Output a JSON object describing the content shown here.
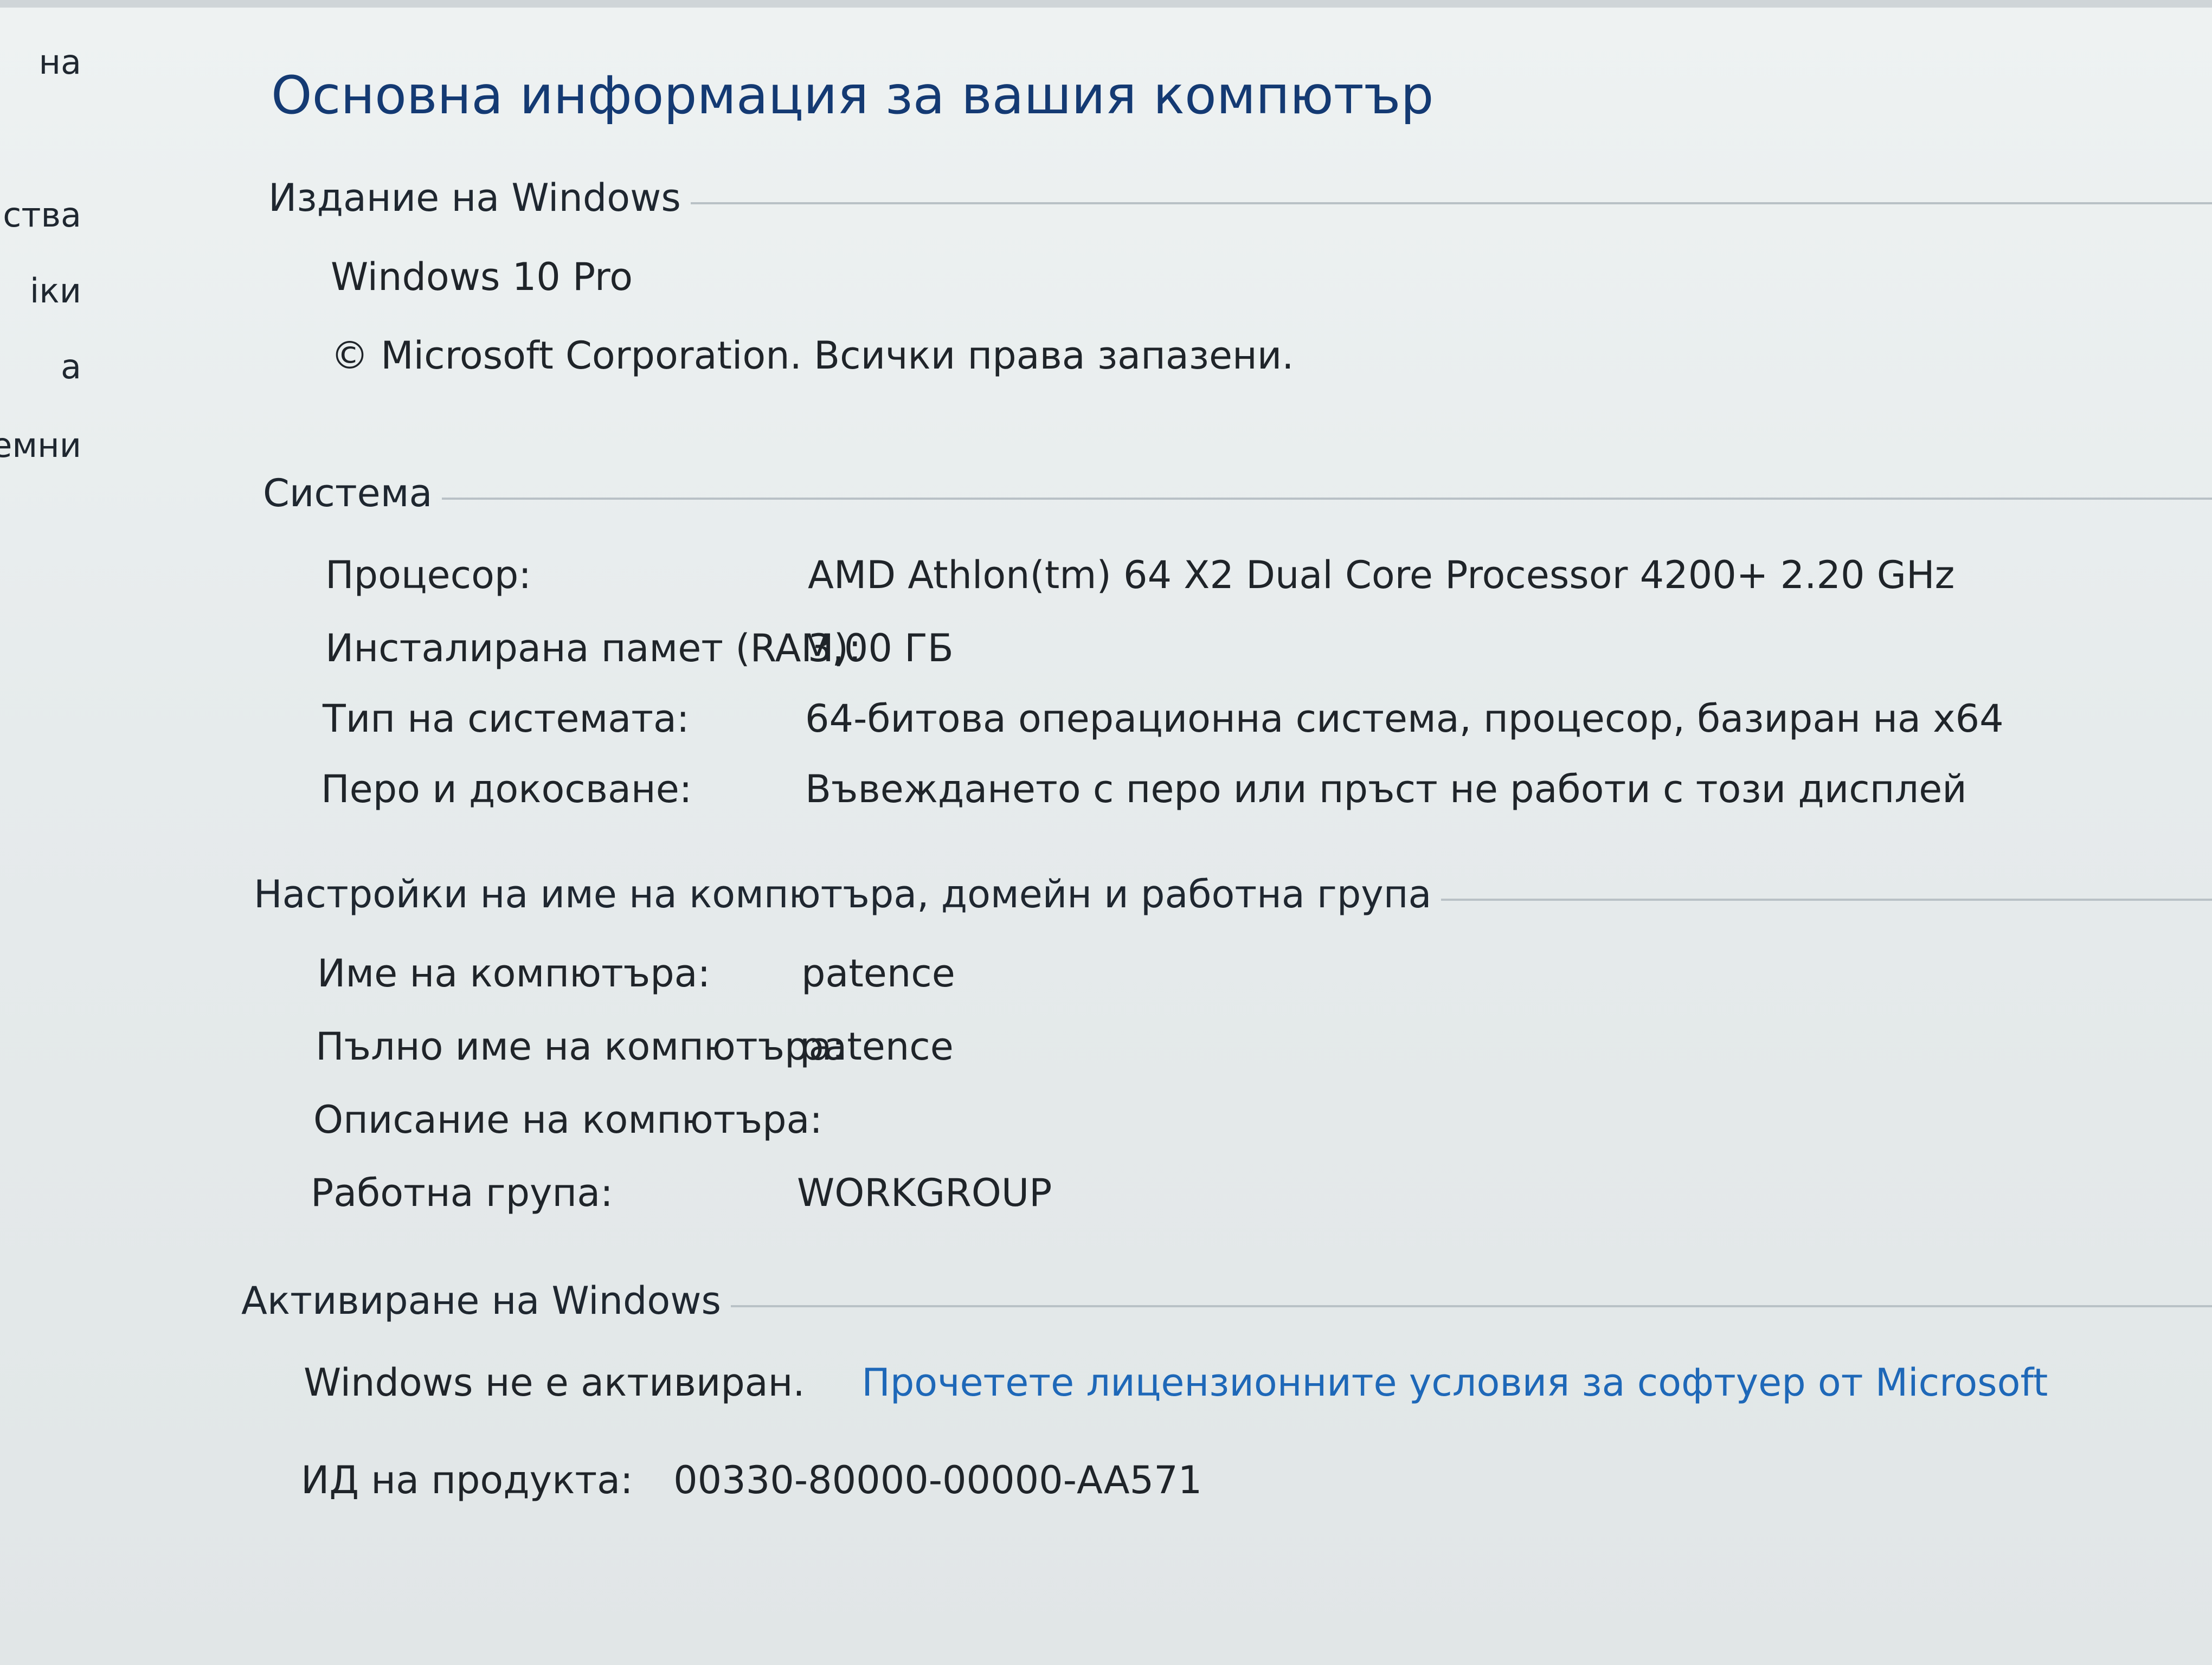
{
  "sidebar": {
    "items": [
      {
        "label": "на"
      },
      {
        "label": "ства"
      },
      {
        "label": "іки"
      },
      {
        "label": "а"
      },
      {
        "label": "емни"
      }
    ]
  },
  "page": {
    "title": "Основна информация за вашия компютър"
  },
  "edition": {
    "header": "Издание на Windows",
    "name": "Windows 10 Pro",
    "copyright": "© Microsoft Corporation. Всички права запазени."
  },
  "system": {
    "header": "Система",
    "rows": [
      {
        "label": "Процесор:",
        "value": "AMD Athlon(tm) 64 X2 Dual Core Processor 4200+   2.20 GHz"
      },
      {
        "label": "Инсталирана памет (RAM):",
        "value": "3,00 ГБ"
      },
      {
        "label": "Тип на системата:",
        "value": "64-битова операционна система, процесор, базиран на x64"
      },
      {
        "label": "Перо и докосване:",
        "value": "Въвеждането с перо или пръст не работи с този дисплей"
      }
    ]
  },
  "computer": {
    "header": "Настройки на име на компютъра, домейн и работна група",
    "rows": [
      {
        "label": "Име на компютъра:",
        "value": "patence"
      },
      {
        "label": "Пълно име на компютъра:",
        "value": "patence"
      },
      {
        "label": "Описание на компютъра:",
        "value": ""
      },
      {
        "label": "Работна група:",
        "value": "WORKGROUP"
      }
    ]
  },
  "activation": {
    "header": "Активиране на Windows",
    "status": "Windows не е активиран.",
    "license_link": "Прочетете лицензионните условия за софтуер от Microsoft",
    "product_id_label": "ИД на продукта:",
    "product_id": "00330-80000-00000-AA571"
  },
  "colors": {
    "title": "#143a73",
    "link": "#1e68b8",
    "text": "#1f2429"
  }
}
